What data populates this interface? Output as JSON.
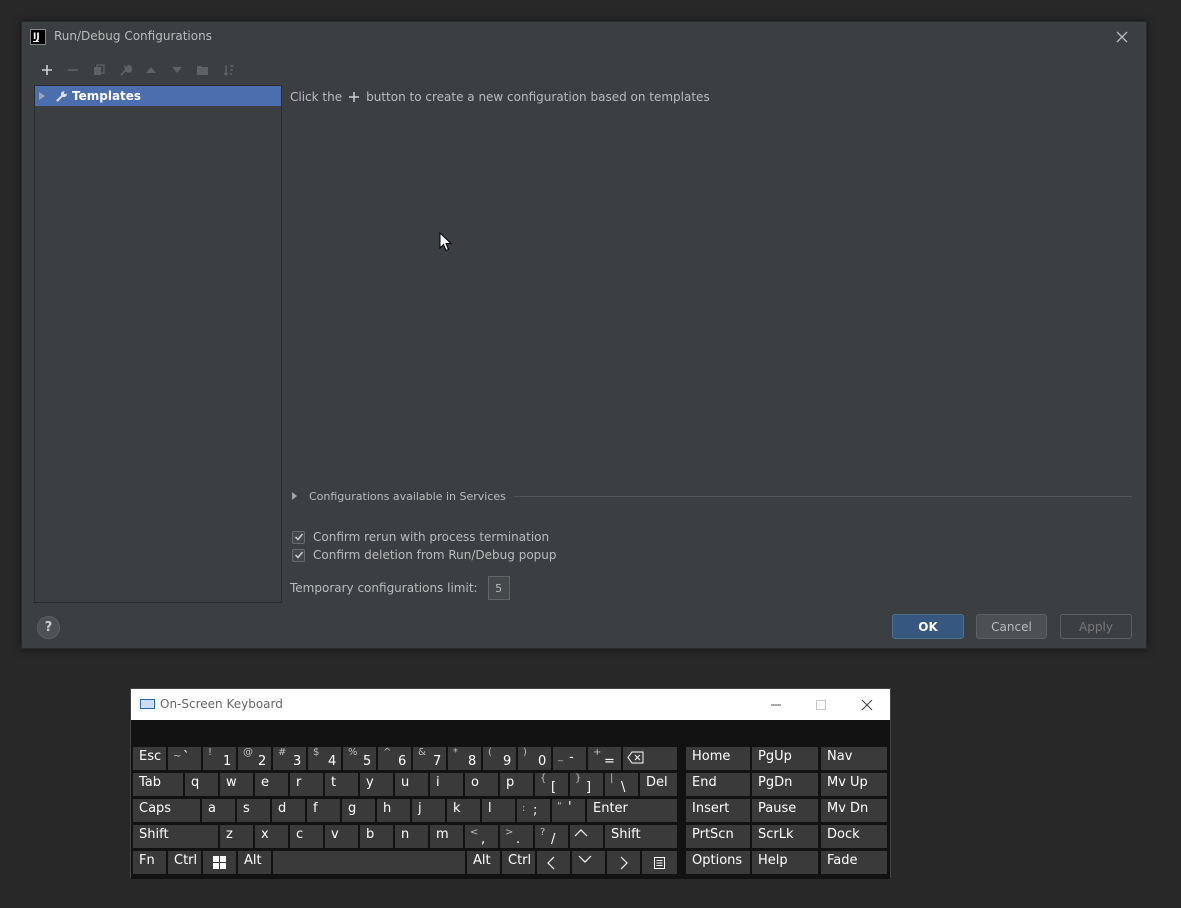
{
  "dialog": {
    "title": "Run/Debug Configurations",
    "app_icon_text": "IJ",
    "tree": {
      "templates_label": "Templates"
    },
    "hint": {
      "before": "Click the",
      "after": "button to create a new configuration based on templates"
    },
    "services_label": "Configurations available in Services",
    "checkboxes": [
      {
        "label": "Confirm rerun with process termination",
        "checked": true
      },
      {
        "label": "Confirm deletion from Run/Debug popup",
        "checked": true
      }
    ],
    "limit": {
      "label": "Temporary configurations limit:",
      "value": "5"
    },
    "buttons": {
      "help": "?",
      "ok": "OK",
      "cancel": "Cancel",
      "apply": "Apply"
    }
  },
  "osk": {
    "title": "On-Screen Keyboard",
    "keys": {
      "esc": "Esc",
      "tilde_shift": "~",
      "tilde": "`",
      "d1s": "!",
      "d1": "1",
      "d2s": "@",
      "d2": "2",
      "d3s": "#",
      "d3": "3",
      "d4s": "$",
      "d4": "4",
      "d5s": "%",
      "d5": "5",
      "d6s": "^",
      "d6": "6",
      "d7s": "&",
      "d7": "7",
      "d8s": "*",
      "d8": "8",
      "d9s": "(",
      "d9": "9",
      "d0s": ")",
      "d0": "0",
      "minus_s": "_",
      "minus": "-",
      "eq_s": "+",
      "eq": "=",
      "home": "Home",
      "pgup": "PgUp",
      "nav": "Nav",
      "tab": "Tab",
      "q": "q",
      "w": "w",
      "e": "e",
      "r": "r",
      "t": "t",
      "y": "y",
      "u": "u",
      "i": "i",
      "o": "o",
      "p": "p",
      "lbr_s": "{",
      "lbr": "[",
      "rbr_s": "}",
      "rbr": "]",
      "bsl_s": "|",
      "bsl": "\\",
      "del": "Del",
      "end": "End",
      "pgdn": "PgDn",
      "mvup": "Mv Up",
      "caps": "Caps",
      "a": "a",
      "s": "s",
      "d": "d",
      "f": "f",
      "g": "g",
      "h": "h",
      "j": "j",
      "k": "k",
      "l": "l",
      "semi_s": ":",
      "semi": ";",
      "quote_s": "\"",
      "quote": "'",
      "enter": "Enter",
      "insert": "Insert",
      "pause": "Pause",
      "mvdn": "Mv Dn",
      "shift": "Shift",
      "z": "z",
      "x": "x",
      "c": "c",
      "v": "v",
      "b": "b",
      "n": "n",
      "m": "m",
      "comma_s": "<",
      "comma": ",",
      "period_s": ">",
      "period": ".",
      "slash_s": "?",
      "slash": "/",
      "rshift": "Shift",
      "prtscn": "PrtScn",
      "scrlk": "ScrLk",
      "dock": "Dock",
      "fn": "Fn",
      "ctrl": "Ctrl",
      "alt": "Alt",
      "ralt": "Alt",
      "rctrl": "Ctrl",
      "options": "Options",
      "help": "Help",
      "fade": "Fade"
    }
  },
  "colors": {
    "accent": "#4b6eaf",
    "ok_button": "#365880",
    "dialog_bg": "#3c3f41"
  }
}
